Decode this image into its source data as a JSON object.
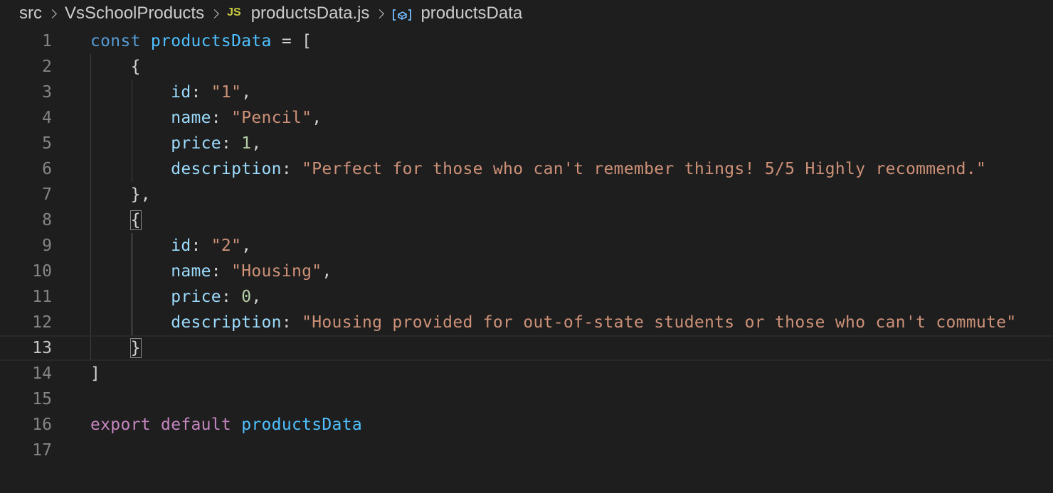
{
  "breadcrumb": {
    "items": [
      "src",
      "VsSchoolProducts",
      "productsData.js",
      "productsData"
    ],
    "file_icon_text": "JS",
    "file_icon": "javascript-file-icon",
    "symbol_icon": "variable-symbol-icon"
  },
  "editor": {
    "language": "javascript",
    "current_line": 13,
    "line_numbers": [
      "1",
      "2",
      "3",
      "4",
      "5",
      "6",
      "7",
      "8",
      "9",
      "10",
      "11",
      "12",
      "13",
      "14",
      "15",
      "16",
      "17"
    ],
    "lines": [
      [
        {
          "t": "kw",
          "v": "const"
        },
        {
          "t": "punc",
          "v": " "
        },
        {
          "t": "var",
          "v": "productsData"
        },
        {
          "t": "punc",
          "v": " = ["
        }
      ],
      [
        {
          "t": "punc",
          "v": "    {"
        }
      ],
      [
        {
          "t": "punc",
          "v": "        "
        },
        {
          "t": "prop",
          "v": "id"
        },
        {
          "t": "punc",
          "v": ": "
        },
        {
          "t": "str",
          "v": "\"1\""
        },
        {
          "t": "punc",
          "v": ","
        }
      ],
      [
        {
          "t": "punc",
          "v": "        "
        },
        {
          "t": "prop",
          "v": "name"
        },
        {
          "t": "punc",
          "v": ": "
        },
        {
          "t": "str",
          "v": "\"Pencil\""
        },
        {
          "t": "punc",
          "v": ","
        }
      ],
      [
        {
          "t": "punc",
          "v": "        "
        },
        {
          "t": "prop",
          "v": "price"
        },
        {
          "t": "punc",
          "v": ": "
        },
        {
          "t": "num",
          "v": "1"
        },
        {
          "t": "punc",
          "v": ","
        }
      ],
      [
        {
          "t": "punc",
          "v": "        "
        },
        {
          "t": "prop",
          "v": "description"
        },
        {
          "t": "punc",
          "v": ": "
        },
        {
          "t": "str",
          "v": "\"Perfect for those who can't remember things! 5/5 Highly recommend.\""
        }
      ],
      [
        {
          "t": "punc",
          "v": "    },"
        }
      ],
      [
        {
          "t": "punc",
          "v": "    "
        },
        {
          "t": "bracket",
          "v": "{"
        }
      ],
      [
        {
          "t": "punc",
          "v": "        "
        },
        {
          "t": "prop",
          "v": "id"
        },
        {
          "t": "punc",
          "v": ": "
        },
        {
          "t": "str",
          "v": "\"2\""
        },
        {
          "t": "punc",
          "v": ","
        }
      ],
      [
        {
          "t": "punc",
          "v": "        "
        },
        {
          "t": "prop",
          "v": "name"
        },
        {
          "t": "punc",
          "v": ": "
        },
        {
          "t": "str",
          "v": "\"Housing\""
        },
        {
          "t": "punc",
          "v": ","
        }
      ],
      [
        {
          "t": "punc",
          "v": "        "
        },
        {
          "t": "prop",
          "v": "price"
        },
        {
          "t": "punc",
          "v": ": "
        },
        {
          "t": "num",
          "v": "0"
        },
        {
          "t": "punc",
          "v": ","
        }
      ],
      [
        {
          "t": "punc",
          "v": "        "
        },
        {
          "t": "prop",
          "v": "description"
        },
        {
          "t": "punc",
          "v": ": "
        },
        {
          "t": "str",
          "v": "\"Housing provided for out-of-state students or those who can't commute\""
        }
      ],
      [
        {
          "t": "punc",
          "v": "    "
        },
        {
          "t": "bracket",
          "v": "}"
        }
      ],
      [
        {
          "t": "punc",
          "v": "]"
        }
      ],
      [],
      [
        {
          "t": "ctrl",
          "v": "export"
        },
        {
          "t": "punc",
          "v": " "
        },
        {
          "t": "ctrl",
          "v": "default"
        },
        {
          "t": "punc",
          "v": " "
        },
        {
          "t": "var",
          "v": "productsData"
        }
      ],
      []
    ]
  },
  "colors": {
    "background": "#1e1e1e",
    "keyword": "#569cd6",
    "variable": "#4fc1ff",
    "property": "#9cdcfe",
    "string": "#ce9178",
    "number": "#b5cea8",
    "control": "#c586c0",
    "line_number": "#858585"
  }
}
